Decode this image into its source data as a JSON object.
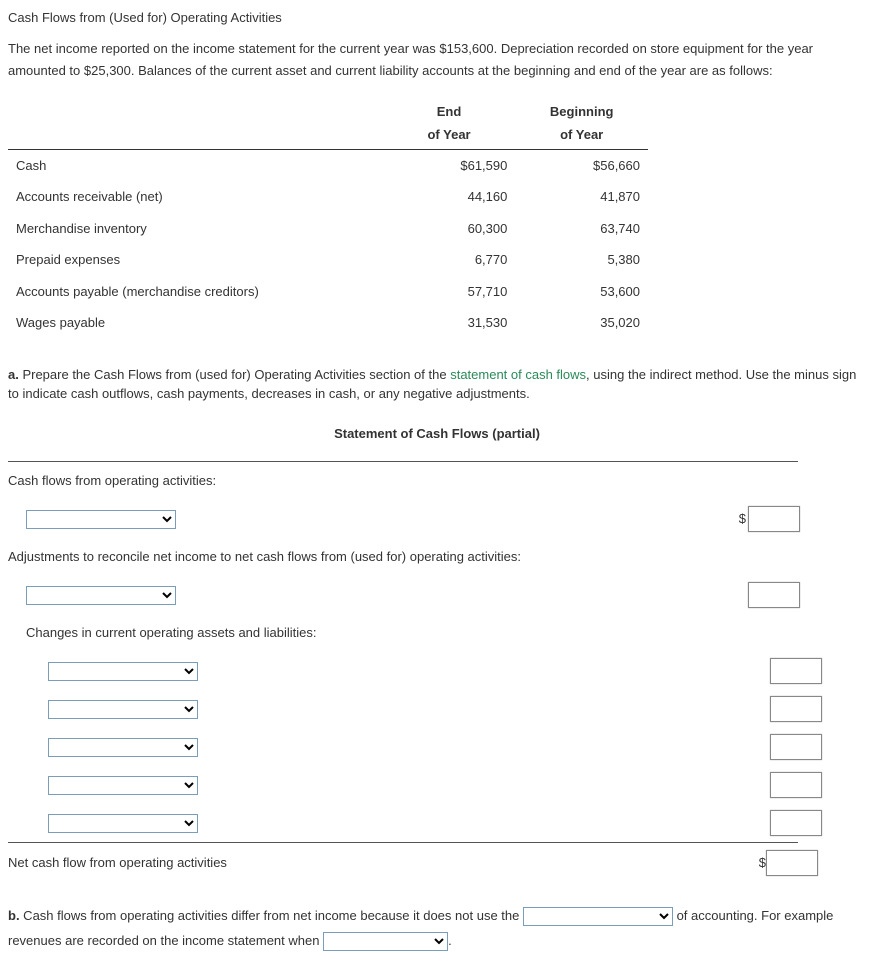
{
  "title": "Cash Flows from (Used for) Operating Activities",
  "intro": "The net income reported on the income statement for the current year was $153,600. Depreciation recorded on store equipment for the year amounted to $25,300. Balances of the current asset and current liability accounts at the beginning and end of the year are as follows:",
  "balances": {
    "col1_top": "End",
    "col1_bot": "of Year",
    "col2_top": "Beginning",
    "col2_bot": "of Year",
    "rows": [
      {
        "label": "Cash",
        "end": "$61,590",
        "beg": "$56,660"
      },
      {
        "label": "Accounts receivable (net)",
        "end": "44,160",
        "beg": "41,870"
      },
      {
        "label": "Merchandise inventory",
        "end": "60,300",
        "beg": "63,740"
      },
      {
        "label": "Prepaid expenses",
        "end": "6,770",
        "beg": "5,380"
      },
      {
        "label": "Accounts payable (merchandise creditors)",
        "end": "57,710",
        "beg": "53,600"
      },
      {
        "label": "Wages payable",
        "end": "31,530",
        "beg": "35,020"
      }
    ]
  },
  "part_a": {
    "lead": "a.",
    "text1": "  Prepare the Cash Flows from (used for) Operating Activities section of the ",
    "link": "statement of cash flows",
    "text2": ", using the indirect method. Use the minus sign to indicate cash outflows, cash payments, decreases in cash, or any negative adjustments.",
    "stmt_title": "Statement of Cash Flows (partial)",
    "line_cfo": "Cash flows from operating activities:",
    "line_adj": "Adjustments to reconcile net income to net cash flows from (used for) operating activities:",
    "line_changes": "Changes in current operating assets and liabilities:",
    "line_net": "Net cash flow from operating activities",
    "dollar": "$"
  },
  "part_b": {
    "lead": "b.",
    "text1": "  Cash flows from operating activities differ from net income because it does not use the ",
    "text2": " of accounting. For example revenues are recorded on the income statement when ",
    "period": "."
  }
}
